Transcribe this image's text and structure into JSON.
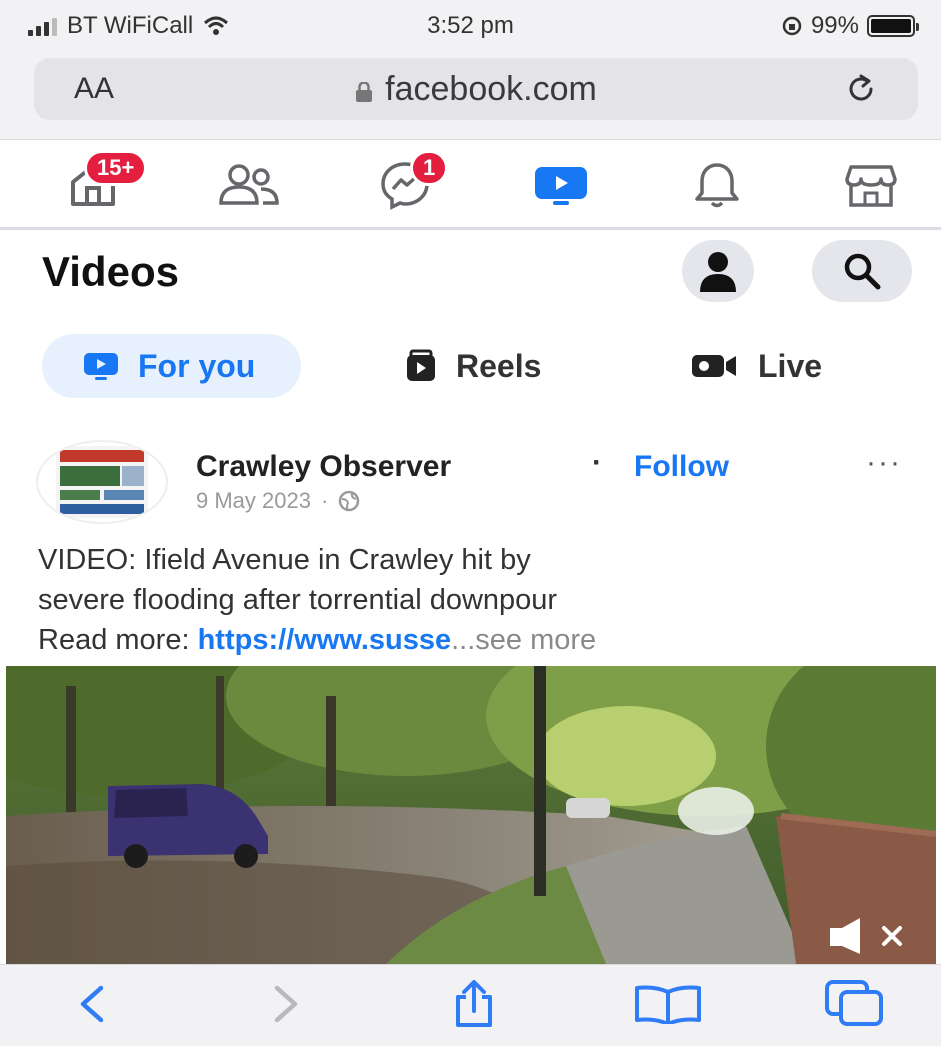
{
  "status_bar": {
    "carrier": "BT WiFiCall",
    "time": "3:52 pm",
    "battery_text": "99%",
    "battery_level": 0.99
  },
  "browser": {
    "text_size_button": "AA",
    "url": "facebook.com"
  },
  "fb_nav": {
    "home_badge": "15+",
    "messages_badge": "1"
  },
  "header": {
    "title": "Videos"
  },
  "tabs": [
    {
      "label": "For you",
      "active": true
    },
    {
      "label": "Reels",
      "active": false
    },
    {
      "label": "Live",
      "active": false
    }
  ],
  "post": {
    "author": "Crawley Observer",
    "separator": "·",
    "follow_label": "Follow",
    "more_label": "···",
    "date": "9 May 2023",
    "date_separator": "·",
    "text_line1": "VIDEO: Ifield Avenue in Crawley hit by",
    "text_line2": "severe flooding after torrential downpour",
    "read_more_prefix": "Read more: ",
    "link_text": "https://www.susse",
    "see_more": "...see more"
  },
  "colors": {
    "fb_blue": "#1877f2",
    "badge_red": "#e41e3f",
    "safari_blue": "#2f7cf6"
  }
}
